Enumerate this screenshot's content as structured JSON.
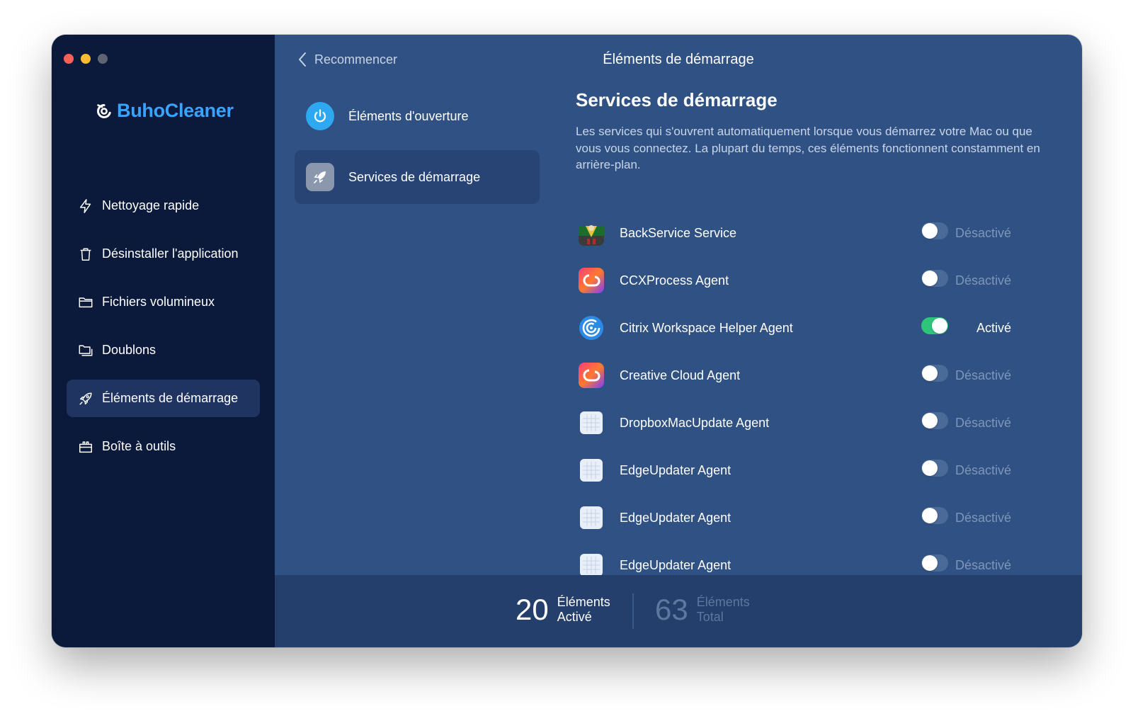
{
  "window": {
    "traffic_lights": [
      "close",
      "minimize",
      "zoom"
    ]
  },
  "sidebar": {
    "brand": "BuhoCleaner",
    "items": [
      {
        "label": "Nettoyage rapide",
        "icon": "bolt-icon"
      },
      {
        "label": "Désinstaller l'application",
        "icon": "trash-icon"
      },
      {
        "label": "Fichiers volumineux",
        "icon": "folder-icon"
      },
      {
        "label": "Doublons",
        "icon": "duplicate-folder-icon"
      },
      {
        "label": "Éléments de démarrage",
        "icon": "rocket-icon",
        "active": true
      },
      {
        "label": "Boîte à outils",
        "icon": "toolbox-icon"
      }
    ]
  },
  "header": {
    "back_label": "Recommencer",
    "title": "Éléments de démarrage"
  },
  "categories": [
    {
      "label": "Éléments d'ouverture",
      "icon": "power-icon"
    },
    {
      "label": "Services de démarrage",
      "icon": "rocket-icon",
      "active": true
    }
  ],
  "section": {
    "title": "Services de démarrage",
    "description": "Les services qui s'ouvrent automatiquement lorsque vous démarrez votre Mac ou que vous vous connectez. La plupart du temps, ces éléments fonctionnent constamment en arrière-plan."
  },
  "items": [
    {
      "name": "BackService Service",
      "status": "Désactivé",
      "enabled": false,
      "icon": "backservice-icon"
    },
    {
      "name": "CCXProcess Agent",
      "status": "Désactivé",
      "enabled": false,
      "icon": "creative-cloud-icon"
    },
    {
      "name": "Citrix Workspace Helper Agent",
      "status": "Activé",
      "enabled": true,
      "icon": "citrix-icon"
    },
    {
      "name": "Creative Cloud Agent",
      "status": "Désactivé",
      "enabled": false,
      "icon": "creative-cloud-icon"
    },
    {
      "name": "DropboxMacUpdate Agent",
      "status": "Désactivé",
      "enabled": false,
      "icon": "generic-app-icon"
    },
    {
      "name": "EdgeUpdater Agent",
      "status": "Désactivé",
      "enabled": false,
      "icon": "generic-app-icon"
    },
    {
      "name": "EdgeUpdater Agent",
      "status": "Désactivé",
      "enabled": false,
      "icon": "generic-app-icon"
    },
    {
      "name": "EdgeUpdater Agent",
      "status": "Désactivé",
      "enabled": false,
      "icon": "generic-app-icon"
    }
  ],
  "footer": {
    "active_count": "20",
    "active_label_1": "Éléments",
    "active_label_2": "Activé",
    "total_count": "63",
    "total_label_1": "Éléments",
    "total_label_2": "Total"
  },
  "colors": {
    "sidebar_bg": "#0b1a3b",
    "main_bg": "#2f5183",
    "brand_blue": "#3aa3ff",
    "toggle_on": "#2ec57a"
  }
}
